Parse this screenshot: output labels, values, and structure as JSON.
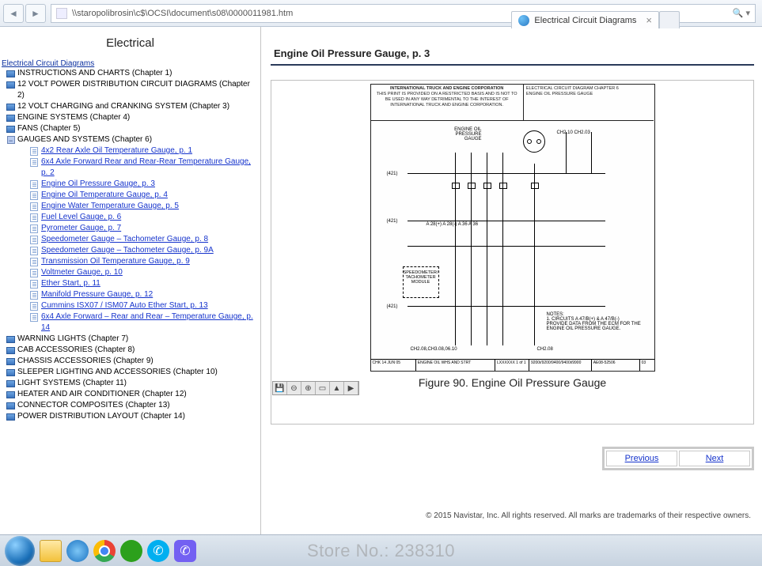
{
  "browser": {
    "url": "\\\\staropolibrosin\\c$\\OCSI\\document\\s08\\0000011981.htm",
    "search_hint": "🔍 ▾",
    "tab_title": "Electrical Circuit Diagrams",
    "tab_close": "×"
  },
  "sidebar": {
    "title": "Electrical",
    "root": "Electrical Circuit Diagrams",
    "chapters": [
      "INSTRUCTIONS AND CHARTS (Chapter 1)",
      "12 VOLT POWER DISTRIBUTION CIRCUIT DIAGRAMS (Chapter 2)",
      "12 VOLT CHARGING and CRANKING SYSTEM (Chapter 3)",
      "ENGINE SYSTEMS (Chapter 4)",
      "FANS (Chapter 5)"
    ],
    "open_chapter": "GAUGES AND SYSTEMS (Chapter 6)",
    "pages": [
      "4x2 Rear Axle Oil Temperature Gauge, p. 1",
      "6x4 Axle Forward Rear and Rear-Rear Temperature Gauge, p. 2",
      "Engine Oil Pressure Gauge, p. 3",
      "Engine Oil Temperature Gauge, p. 4",
      "Engine Water Temperature Gauge, p. 5",
      "Fuel Level Gauge, p. 6",
      "Pyrometer Gauge, p. 7",
      "Speedometer Gauge – Tachometer Gauge, p. 8",
      "Speedometer Gauge – Tachometer Gauge, p. 9A",
      "Transmission Oil Temperature Gauge, p. 9",
      "Voltmeter Gauge, p. 10",
      "Ether Start, p. 11",
      "Manifold Pressure Gauge, p. 12",
      "Cummins ISX07 / ISM07 Auto Ether Start, p. 13",
      "6x4 Axle Forward – Rear and Rear – Temperature Gauge, p. 14"
    ],
    "chapters_after": [
      "WARNING LIGHTS (Chapter 7)",
      "CAB ACCESSORIES (Chapter 8)",
      "CHASSIS ACCESSORIES (Chapter 9)",
      "SLEEPER LIGHTING AND ACCESSORIES (Chapter 10)",
      "LIGHT SYSTEMS (Chapter 11)",
      "HEATER AND AIR CONDITIONER (Chapter 12)",
      "CONNECTOR COMPOSITES (Chapter 13)",
      "POWER DISTRIBUTION LAYOUT (Chapter 14)"
    ]
  },
  "main": {
    "title": "Engine Oil Pressure Gauge, p. 3",
    "diagram": {
      "header_left_line1": "INTERNATIONAL TRUCK AND ENGINE CORPORATION",
      "header_left_line2": "THIS PRINT IS PROVIDED ON A RESTRICTED BASIS AND IS NOT TO BE USED IN ANY WAY DETRIMENTAL TO THE INTEREST OF INTERNATIONAL TRUCK AND ENGINE CORPORATION.",
      "header_right_line1": "ELECTRICAL CIRCUIT DIAGRAM    CHAPTER  6",
      "header_right_line2": "ENGINE OIL PRESSURE GAUGE",
      "label_gauge": "ENGINE OIL PRESSURE GAUGE",
      "label_spd": "SPEEDOMETER/ TACHOMETER MODULE",
      "conn_421_a": "(421)",
      "conn_421_b": "(421)",
      "conn_421_c": "(421)",
      "wire_note_1": "CH2.10   CH2.03",
      "wire_note_2": "A 28(+) A 28(-)  A 36  A 36",
      "notes_title": "NOTES:",
      "notes_body": "1. CIRCUITS A 47/B(+) & A 47/B(-) PROVIDE DATA FROM THE ECM FOR THE ENGINE OIL PRESSURE GAUGE.",
      "bottom_ref_l": "CH2.08,CH3.08,06.10",
      "bottom_ref_r": "CH2.08",
      "title_block_chk": "CHK  14 JUN 05",
      "title_block_name": "ENGINE OIL WHS AND STRT",
      "title_block_used": "9200i/9200/9400/9400i/9900",
      "title_block_part": "AE08-52506",
      "title_block_rev": "03",
      "title_block_date": "LXXXXXX   1 of 1"
    },
    "caption": "Figure 90. Engine Oil Pressure Gauge",
    "toolbar": {
      "save": "💾",
      "zoomout": "⊖",
      "zoomin": "⊕",
      "fit": "▭",
      "up": "▲",
      "right": "▶"
    },
    "prev": "Previous",
    "next": "Next",
    "copyright": "© 2015 Navistar, Inc. All rights reserved. All marks are trademarks of their respective owners."
  },
  "watermark": "Store No.: 238310"
}
